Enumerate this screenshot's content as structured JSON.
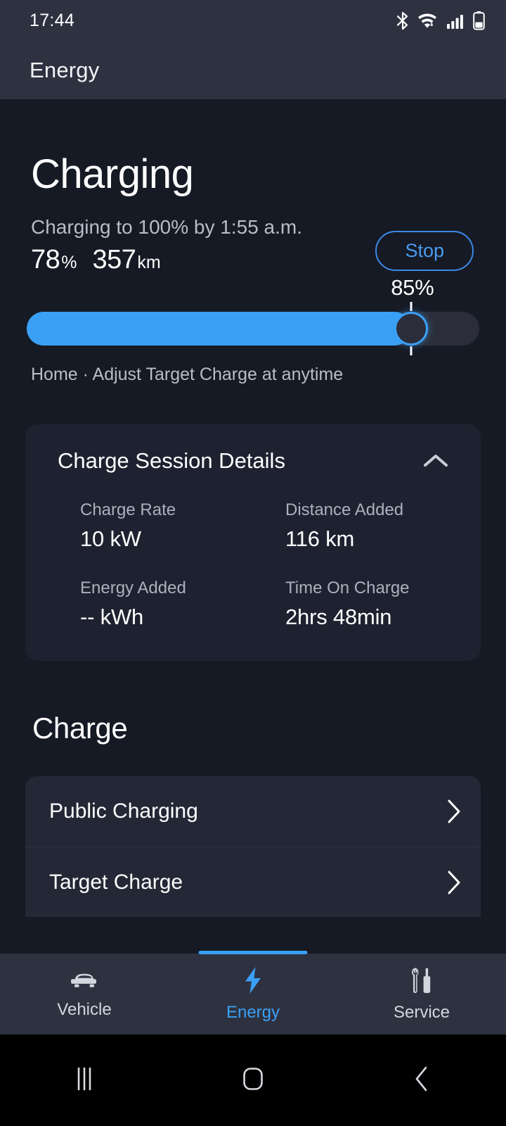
{
  "statusbar": {
    "time": "17:44",
    "icons": [
      "bluetooth-icon",
      "wifi-icon",
      "cellular-signal-icon",
      "battery-icon"
    ]
  },
  "appbar": {
    "title": "Energy"
  },
  "charging": {
    "heading": "Charging",
    "eta_text": "Charging to 100% by 1:55 a.m.",
    "battery_percent": "78",
    "percent_symbol": "%",
    "range_value": "357",
    "range_unit": "km",
    "stop_label": "Stop"
  },
  "slider": {
    "target_label": "85%",
    "target_percent": 85,
    "fill_color": "#3aa0f5",
    "track_color": "#2b2e3a",
    "caption": "Home · Adjust Target Charge at anytime"
  },
  "session_details": {
    "title": "Charge Session Details",
    "collapse_icon": "chevron-up-icon",
    "metrics": [
      {
        "label": "Charge Rate",
        "value": "10 kW"
      },
      {
        "label": "Distance Added",
        "value": "116 km"
      },
      {
        "label": "Energy Added",
        "value": "-- kWh"
      },
      {
        "label": "Time On Charge",
        "value": "2hrs 48min"
      }
    ]
  },
  "charge_section": {
    "heading": "Charge",
    "items": [
      {
        "label": "Public Charging",
        "chevron": "chevron-right-icon"
      },
      {
        "label": "Target Charge",
        "chevron": "chevron-right-icon"
      }
    ]
  },
  "bottomnav": {
    "accent_color": "#3aa0f5",
    "tabs": [
      {
        "label": "Vehicle",
        "icon": "car-icon",
        "active": false
      },
      {
        "label": "Energy",
        "icon": "lightning-bolt-icon",
        "active": true
      },
      {
        "label": "Service",
        "icon": "wrench-screwdriver-icon",
        "active": false
      }
    ]
  },
  "sysnav": {
    "buttons": [
      {
        "name": "recents-button",
        "icon": "three-bars-icon"
      },
      {
        "name": "home-button",
        "icon": "rounded-square-icon"
      },
      {
        "name": "back-button",
        "icon": "chevron-left-icon"
      }
    ]
  }
}
